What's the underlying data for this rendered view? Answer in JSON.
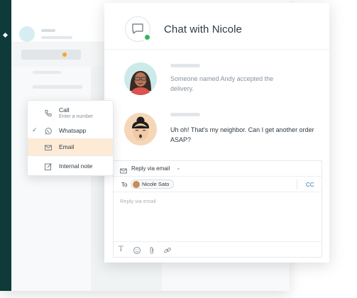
{
  "chat": {
    "title": "Chat with Nicole",
    "messages": [
      {
        "text": "Someone named Andy accepted the delivery."
      },
      {
        "text": "Uh oh! That's my neighbor. Can I get another order ASAP?"
      }
    ]
  },
  "menu": {
    "items": [
      {
        "label": "Call",
        "sublabel": "Enter a number",
        "icon": "phone-icon",
        "checked": false
      },
      {
        "label": "Whatsapp",
        "icon": "whatsapp-icon",
        "checked": true
      },
      {
        "label": "Email",
        "icon": "mail-icon",
        "checked": false,
        "highlighted": true
      },
      {
        "label": "Internal note",
        "icon": "note-icon",
        "checked": false
      }
    ]
  },
  "composer": {
    "reply_mode": "Reply via email",
    "to_label": "To",
    "recipient": "Nicole Sato",
    "cc_label": "CC",
    "placeholder": "Reply via email",
    "tools": [
      "text-format-icon",
      "emoji-icon",
      "attachment-icon",
      "link-icon"
    ]
  },
  "colors": {
    "rail": "#0f3a3a",
    "online": "#2fb864",
    "menu_highlight": "#fdebd7",
    "link": "#1f73b7",
    "status_dot": "#f5a623"
  }
}
